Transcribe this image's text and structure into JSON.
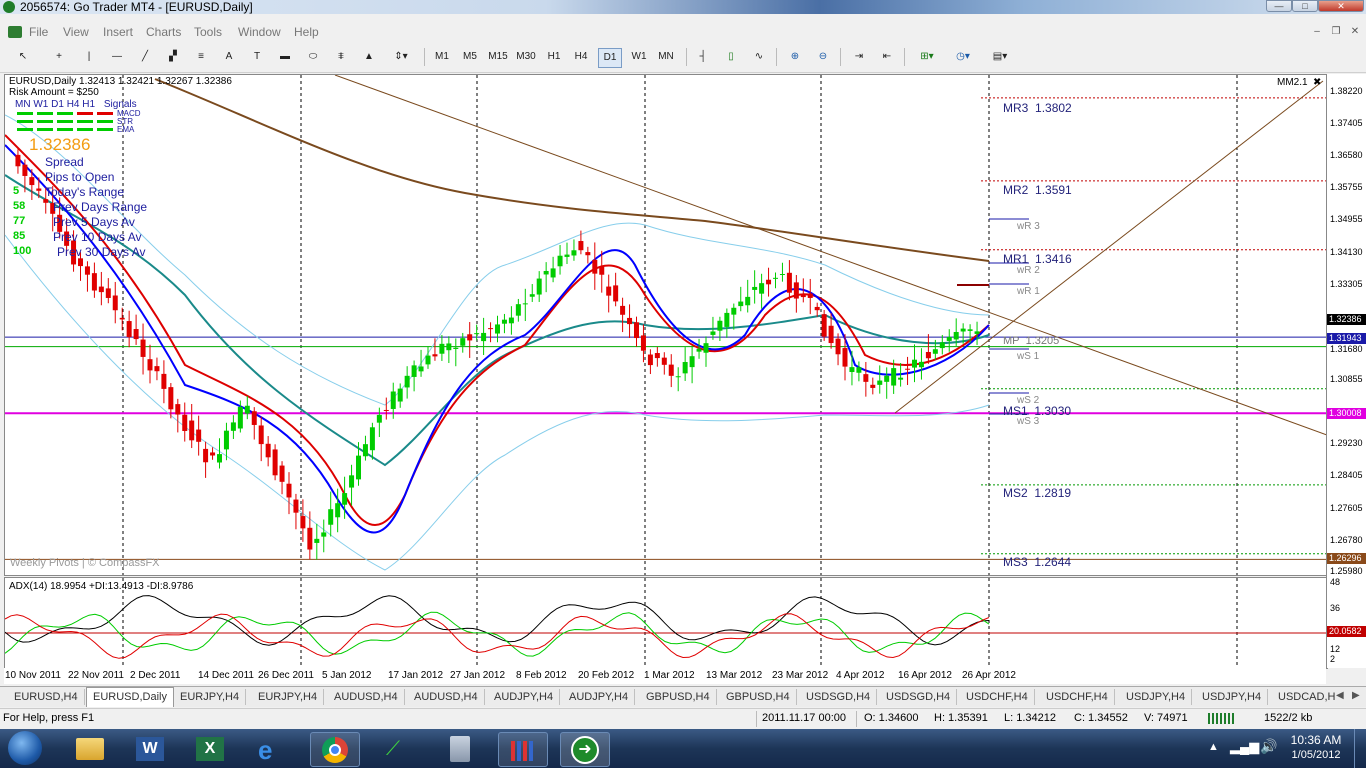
{
  "window": {
    "title": "2056574: Go Trader MT4 - [EURUSD,Daily]",
    "minimize": "—",
    "maximize": "□",
    "close": "✕"
  },
  "menu": [
    "File",
    "View",
    "Insert",
    "Charts",
    "Tools",
    "Window",
    "Help"
  ],
  "toolbar": {
    "timeframes": [
      "M1",
      "M5",
      "M15",
      "M30",
      "H1",
      "H4",
      "D1",
      "W1",
      "MN"
    ],
    "active_timeframe": "D1"
  },
  "chart": {
    "header": "EURUSD,Daily  1.32413 1.32421 1.32267 1.32386",
    "risk_amount": "Risk Amount = $250",
    "signal_headers": [
      "MN",
      "W1",
      "D1",
      "H4",
      "H1",
      "Signals"
    ],
    "signal_rows": [
      "MACD",
      "STR",
      "EMA"
    ],
    "big_price": "1.32386",
    "info_labels": [
      {
        "value": "",
        "label": "Spread"
      },
      {
        "value": "",
        "label": "Pips to Open"
      },
      {
        "value": "5",
        "label": "Today's Range"
      },
      {
        "value": "58",
        "label": "Prev Days Range"
      },
      {
        "value": "77",
        "label": "Prev 5 Days Av"
      },
      {
        "value": "85",
        "label": "Prev 10 Days Av"
      },
      {
        "value": "100",
        "label": "Prev 30 Days Av"
      }
    ],
    "indicator_name": "MM2.1",
    "watermark": "Weekly Pivots | © CompassFX",
    "pivots": [
      {
        "label": "MR3",
        "value": "1.3802"
      },
      {
        "label": "MR2",
        "value": "1.3591"
      },
      {
        "label": "MR1",
        "value": "1.3416"
      },
      {
        "label": "MP",
        "value": "1.3205"
      },
      {
        "label": "MS1",
        "value": "1.3030"
      },
      {
        "label": "MS2",
        "value": "1.2819"
      },
      {
        "label": "MS3",
        "value": "1.2644"
      }
    ],
    "weekly_levels": [
      "wR 3",
      "wR 2",
      "wR 1",
      "wS 1",
      "wS 2",
      "wS 3"
    ],
    "price_ticks": [
      "1.38220",
      "1.37405",
      "1.36580",
      "1.35755",
      "1.34955",
      "1.34130",
      "1.33305",
      "1.32386",
      "1.31943",
      "1.31680",
      "1.30855",
      "1.30008",
      "1.29230",
      "1.28405",
      "1.27605",
      "1.26780",
      "1.26296",
      "1.25980"
    ],
    "highlight_prices": [
      {
        "value": "1.32386",
        "color": "#000000"
      },
      {
        "value": "1.31943",
        "color": "#1a1aa8"
      },
      {
        "value": "1.30008",
        "color": "#e000e0"
      },
      {
        "value": "1.26296",
        "color": "#8a4a1a"
      }
    ],
    "dates": [
      "10 Nov 2011",
      "22 Nov 2011",
      "2 Dec 2011",
      "14 Dec 2011",
      "26 Dec 2011",
      "5 Jan 2012",
      "17 Jan 2012",
      "27 Jan 2012",
      "8 Feb 2012",
      "20 Feb 2012",
      "1 Mar 2012",
      "13 Mar 2012",
      "23 Mar 2012",
      "4 Apr 2012",
      "16 Apr 2012",
      "26 Apr 2012"
    ]
  },
  "adx": {
    "header": "ADX(14) 18.9954 +DI:13.4913 -DI:8.9786",
    "scale": [
      "48",
      "36",
      "20.0582",
      "12",
      "2"
    ]
  },
  "tabs": [
    "EURUSD,H4",
    "EURUSD,Daily",
    "EURJPY,H4",
    "EURJPY,H4",
    "AUDUSD,H4",
    "AUDUSD,H4",
    "AUDJPY,H4",
    "AUDJPY,H4",
    "GBPUSD,H4",
    "GBPUSD,H4",
    "USDSGD,H4",
    "USDSGD,H4",
    "USDCHF,H4",
    "USDCHF,H4",
    "USDJPY,H4",
    "USDJPY,H4",
    "USDCAD,H"
  ],
  "active_tab": "EURUSD,Daily",
  "status": {
    "help": "For Help, press F1",
    "datetime": "2011.11.17 00:00",
    "open": "O: 1.34600",
    "high": "H: 1.35391",
    "low": "L: 1.34212",
    "close": "C: 1.34552",
    "volume": "V: 74971",
    "traffic": "1522/2 kb"
  },
  "taskbar": {
    "time": "10:36 AM",
    "date": "1/05/2012"
  },
  "colors": {
    "bull": "#00cc00",
    "bear": "#e00000",
    "ema_fast": "#0000ff",
    "ema_red": "#dd0000",
    "ema_teal": "#1a8a8a",
    "bollinger": "#87ceeb",
    "sma_brown": "#7a4a1e",
    "pivot_line": "#e000e0"
  }
}
